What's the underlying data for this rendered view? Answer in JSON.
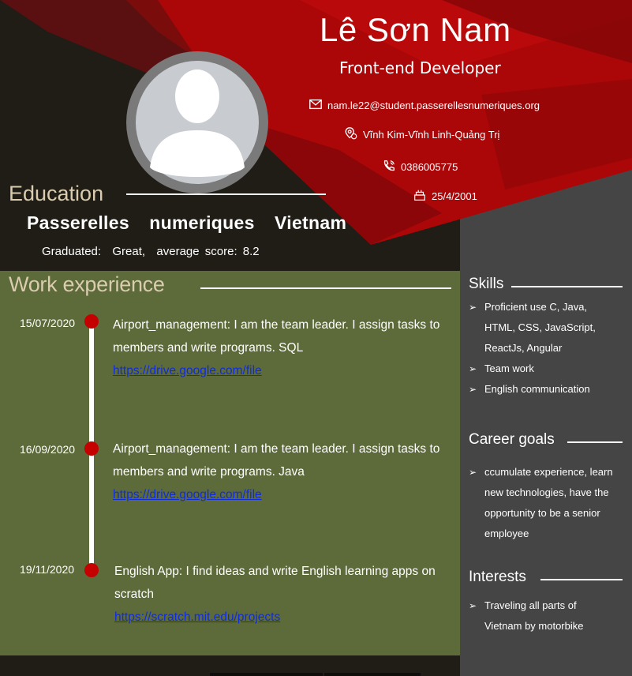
{
  "header": {
    "name": "Lê Sơn Nam",
    "title": "Front-end Developer",
    "email": "nam.le22@student.passerellesnumeriques.org",
    "address": "Vĩnh Kim-Vĩnh Linh-Quảng Trị",
    "phone": "0386005775",
    "birthday": "25/4/2001"
  },
  "education": {
    "heading": "Education",
    "school": "Passerelles  numeriques  Vietnam",
    "details": "Graduated:  Great,  average score: 8.2"
  },
  "work": {
    "heading": "Work experience",
    "items": [
      {
        "date": "15/07/2020",
        "text": "Airport_management: I am the team leader. I assign tasks to members and write programs. SQL",
        "link": "https://drive.google.com/file"
      },
      {
        "date": "16/09/2020",
        "text": "Airport_management: I am the team leader. I assign tasks to members and write programs. Java",
        "link": "https://drive.google.com/file"
      },
      {
        "date": "19/11/2020",
        "text": "English App: I find ideas and write English learning apps on scratch",
        "link": "https://scratch.mit.edu/projects"
      }
    ]
  },
  "skills": {
    "heading": "Skills",
    "items": [
      "Proficient use C, Java, HTML, CSS, JavaScript, ReactJs, Angular",
      "Team work",
      "English communication"
    ]
  },
  "career": {
    "heading": "Career goals",
    "items": [
      "ccumulate experience, learn new technologies, have the opportunity to be a senior employee"
    ]
  },
  "interests": {
    "heading": "Interests",
    "items": [
      "Traveling  all parts of Vietnam by motorbike"
    ]
  },
  "colors": {
    "dark": "#201c16",
    "red": "#ab0709",
    "green": "#5d6a3a",
    "sidebar": "#454545",
    "link": "#0f2cdc"
  },
  "icons": [
    "envelope-icon",
    "location-pin-icon",
    "phone-icon",
    "cake-icon",
    "avatar-silhouette"
  ]
}
